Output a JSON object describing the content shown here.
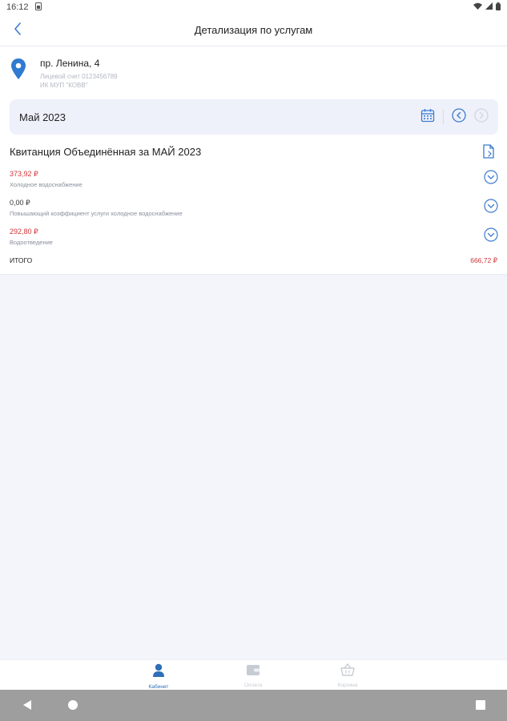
{
  "status": {
    "time": "16:12",
    "sim_icon": "sim-card-icon",
    "wifi_icon": "wifi-icon",
    "signal_icon": "signal-icon",
    "battery_icon": "battery-icon"
  },
  "appbar": {
    "title": "Детализация по услугам",
    "back_icon": "chevron-left-icon"
  },
  "address": {
    "street": "пр. Ленина, 4",
    "account": "Лицевой счет 0123456789",
    "provider": "ИК МУП \"КОВВ\"",
    "pin_icon": "location-pin-icon",
    "pin_color": "#2e7bd1"
  },
  "period": {
    "month": "Май 2023",
    "calendar_icon": "calendar-icon",
    "prev_icon": "chevron-left-circle-icon",
    "next_icon": "chevron-right-circle-icon"
  },
  "receipt": {
    "title": "Квитанция Объединённая за МАЙ 2023",
    "doc_icon": "document-icon",
    "items": [
      {
        "amount": "373,92 ₽",
        "name": "Холодное водоснабжение",
        "color": "red"
      },
      {
        "amount": "0,00 ₽",
        "name": "Повышающий коэффициент услуги холодное водоснабжение",
        "color": "black"
      },
      {
        "amount": "292,80 ₽",
        "name": "Водоотведение",
        "color": "red"
      }
    ],
    "total_label": "ИТОГО",
    "total_value": "666,72 ₽"
  },
  "nav": {
    "items": [
      {
        "label": "Кабинет",
        "icon": "user-icon",
        "active": true
      },
      {
        "label": "Оплата",
        "icon": "wallet-icon",
        "active": false
      },
      {
        "label": "Корзина",
        "icon": "basket-icon",
        "active": false
      }
    ]
  },
  "colors": {
    "accent": "#2e6fb7",
    "debt": "#d0353a",
    "month_bar": "#eef1fa"
  }
}
